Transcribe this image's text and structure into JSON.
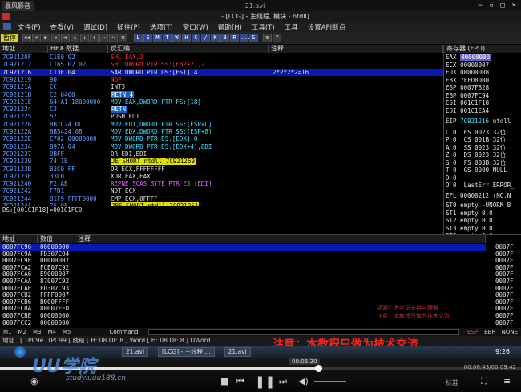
{
  "player": {
    "brand": "暴风影音",
    "file_title": "21.avi",
    "window_controls": [
      "minimize-icon",
      "restore-icon",
      "maximize-icon",
      "close-icon"
    ],
    "progress_pct": 61,
    "time_bubble": "00:06:20",
    "time_display": "00:06:43/00:09:42",
    "btn_quality": "标准",
    "ctrl_icons": [
      "eye-icon",
      "stop-icon",
      "prev-icon",
      "pause-icon",
      "next-icon",
      "volume-icon"
    ]
  },
  "od": {
    "title": "- [LCG] - 主线程, 模块 - ntdll]",
    "menu": [
      "文件(F)",
      "查看(V)",
      "调试(D)",
      "插件(P)",
      "选项(T)",
      "窗口(W)",
      "帮助(H)",
      "工具(T)",
      "工具",
      "设置API断点"
    ],
    "status_badge": "暂停",
    "toolbar_symbols": [
      "◀◀",
      "✕",
      "▶",
      "⏸",
      "⇉",
      "↘",
      "↓",
      "↑",
      "→",
      "↪",
      "≡"
    ],
    "toolbar_letters": [
      "L",
      "E",
      "M",
      "T",
      "W",
      "H",
      "C",
      "/",
      "K",
      "B",
      "R",
      "...",
      "S"
    ],
    "toolbar_right": [
      "≡",
      "?"
    ],
    "cpu": {
      "headers": [
        "地址",
        "HEX 数据",
        "反汇编",
        "注释"
      ],
      "rows": [
        {
          "addr": "7C92120F",
          "hex": "C1E0 02",
          "asm": "SHL EAX,2",
          "cmt": ""
        },
        {
          "addr": "7C921212",
          "hex": "C165 02 02",
          "asm": "SHL DWORD PTR SS:[EBP+2],2",
          "cmt": ""
        },
        {
          "addr": "7C921216",
          "hex": "C13E 04",
          "asm": "SAR DWORD PTR DS:[ESI],4",
          "cmt": "2*2*2*2=16"
        },
        {
          "addr": "7C921219",
          "hex": "90",
          "asm": "NOP",
          "cmt": ""
        },
        {
          "addr": "7C92121A",
          "hex": "CC",
          "asm": "INT3",
          "cmt": ""
        },
        {
          "addr": "7C92121B",
          "hex": "C2 0400",
          "asm": "RETN 4",
          "cmt": ""
        },
        {
          "addr": "7C92121E",
          "hex": "64:A1 18000000",
          "asm": "MOV EAX,DWORD PTR FS:[18]",
          "cmt": ""
        },
        {
          "addr": "7C921224",
          "hex": "C3",
          "asm": "RETN",
          "cmt": ""
        },
        {
          "addr": "7C921225",
          "hex": "57",
          "asm": "PUSH EDI",
          "cmt": ""
        },
        {
          "addr": "7C921226",
          "hex": "8B7C24 0C",
          "asm": "MOV EDI,DWORD PTR SS:[ESP+C]",
          "cmt": ""
        },
        {
          "addr": "7C92122A",
          "hex": "8B5424 08",
          "asm": "MOV EDX,DWORD PTR SS:[ESP+8]",
          "cmt": ""
        },
        {
          "addr": "7C92122E",
          "hex": "C702 00000000",
          "asm": "MOV DWORD PTR DS:[EDX],0",
          "cmt": ""
        },
        {
          "addr": "7C921234",
          "hex": "897A 04",
          "asm": "MOV DWORD PTR DS:[EDX+4],EDI",
          "cmt": ""
        },
        {
          "addr": "7C921237",
          "hex": "0BFF",
          "asm": "OR EDI,EDI",
          "cmt": ""
        },
        {
          "addr": "7C921239",
          "hex": "74 1E",
          "asm": "JE SHORT ntdll.7C921259",
          "cmt": ""
        },
        {
          "addr": "7C92123B",
          "hex": "83C9 FF",
          "asm": "OR ECX,FFFFFFFF",
          "cmt": ""
        },
        {
          "addr": "7C92123E",
          "hex": "33C0",
          "asm": "XOR EAX,EAX",
          "cmt": ""
        },
        {
          "addr": "7C921240",
          "hex": "F2:AE",
          "asm": "REPNE SCAS BYTE PTR ES:[EDI]",
          "cmt": ""
        },
        {
          "addr": "7C921242",
          "hex": "F7D1",
          "asm": "NOT ECX",
          "cmt": ""
        },
        {
          "addr": "7C921244",
          "hex": "81F9 FFFF0000",
          "asm": "CMP ECX,0FFFF",
          "cmt": ""
        },
        {
          "addr": "7C92124A",
          "hex": "76 05",
          "asm": "JBE SHORT ntdll.7C921251",
          "cmt": ""
        }
      ],
      "info": "DS:[001C1F18]=001C1FC0"
    },
    "registers": {
      "header": "寄存器 (FPU)",
      "gp": [
        {
          "name": "EAX",
          "val": "00000000"
        },
        {
          "name": "ECX",
          "val": "00000007"
        },
        {
          "name": "EDX",
          "val": "00000008"
        },
        {
          "name": "EBX",
          "val": "7FFD8000"
        },
        {
          "name": "ESP",
          "val": "0007F828"
        },
        {
          "name": "EBP",
          "val": "0007FC94"
        },
        {
          "name": "ESI",
          "val": "001C1F18"
        },
        {
          "name": "EDI",
          "val": "001C1EA4"
        }
      ],
      "eip_name": "EIP",
      "eip_val": "7C921216",
      "eip_note": "ntdll",
      "flags": [
        "C 0  ES 0023 32位",
        "P 0  CS 001B 32位",
        "A 0  SS 0023 32位",
        "Z 0  DS 0023 32位",
        "S 0  FS 003B 32位",
        "T 0  GS 0000 NULL",
        "D 0",
        "O 0  LastErr ERROR_",
        "EFL 00000212 (NO,N"
      ],
      "fpu": [
        "ST0 empty -UNORM B",
        "ST1 empty 0.0",
        "ST2 empty 0.0",
        "ST3 empty 0.0",
        "ST4 empty 0.0"
      ]
    },
    "dump": {
      "headers": [
        "地址",
        "数值",
        "注释"
      ],
      "rows": [
        {
          "addr": "0007FC96",
          "val": "00000000"
        },
        {
          "addr": "0007FC9A",
          "val": "FD307C94"
        },
        {
          "addr": "0007FC9E",
          "val": "00000007"
        },
        {
          "addr": "0007FCA2",
          "val": "FCE07C92"
        },
        {
          "addr": "0007FCA6",
          "val": "E9000007"
        },
        {
          "addr": "0007FCAA",
          "val": "87007C92"
        },
        {
          "addr": "0007FCAE",
          "val": "FD307C93"
        },
        {
          "addr": "0007FCB2",
          "val": "FFFF0007"
        },
        {
          "addr": "0007FCB6",
          "val": "B000FFFF"
        },
        {
          "addr": "0007FCBA",
          "val": "80007FFD"
        },
        {
          "addr": "0007FCBE",
          "val": "00000000"
        },
        {
          "addr": "0007FCC2",
          "val": "00000000"
        }
      ],
      "right_labels": [
        "0007F",
        "0007F",
        "0007F",
        "0007F",
        "0007F",
        "0007F",
        "0007F",
        "0007F",
        "0007F",
        "0007F",
        "0007F",
        "0007F"
      ]
    },
    "bottom_tabs": [
      "M1",
      "M2",
      "M3",
      "M4",
      "M5"
    ],
    "command_label": "Command:",
    "right_tabs": [
      "ESP",
      "EBP",
      "NONE"
    ],
    "statusbar": "地址   [ TPC9e  TPC99 [ 线程 [ H: 08 Dr: 8 ] Word [ H: 08 Dr: 8 ] DWord",
    "watermark": "注意：本教程只做为技术交流",
    "watermark_small": [
      "感谢广大学员支持与理解",
      "注意：本教程只做为技术交流"
    ]
  },
  "taskbar": {
    "items": [
      "21.avi",
      "[LCG] - 主线程,...",
      "21.avi"
    ],
    "clock": "9:26"
  },
  "site": {
    "logo": "UU学院",
    "url": "study.uuu188.cn"
  }
}
